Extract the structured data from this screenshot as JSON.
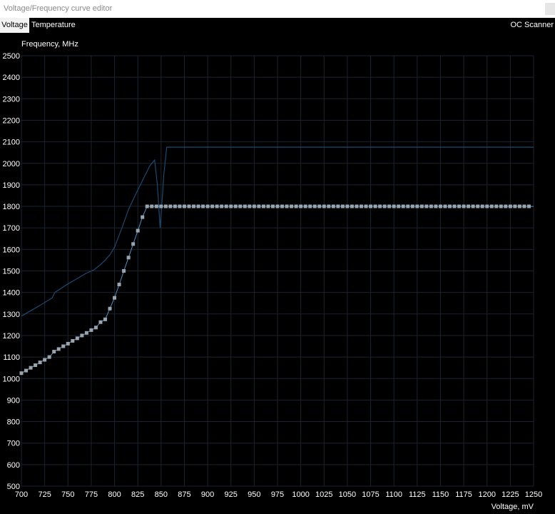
{
  "window": {
    "title": "Voltage/Frequency curve editor"
  },
  "tabs": {
    "voltage": "Voltage",
    "temperature": "Temperature",
    "oc_scanner": "OC Scanner"
  },
  "colors": {
    "grid": "#1c232d",
    "curve": "#4a90c8",
    "reference": "#1a4a72",
    "point": "#9aa4ac",
    "axis_text": "#ffffff"
  },
  "chart_data": {
    "type": "line",
    "xlabel": "Voltage, mV",
    "ylabel": "Frequency, MHz",
    "xlim": [
      700,
      1250
    ],
    "ylim": [
      500,
      2500
    ],
    "x_ticks": [
      700,
      725,
      750,
      775,
      800,
      825,
      850,
      875,
      900,
      925,
      950,
      975,
      1000,
      1025,
      1050,
      1075,
      1100,
      1125,
      1150,
      1175,
      1200,
      1225,
      1250
    ],
    "y_ticks": [
      500,
      600,
      700,
      800,
      900,
      1000,
      1100,
      1200,
      1300,
      1400,
      1500,
      1600,
      1700,
      1800,
      1900,
      2000,
      2100,
      2200,
      2300,
      2400,
      2500
    ],
    "grid": true,
    "series": [
      {
        "role": "curve",
        "x": [
          700,
          705,
          710,
          715,
          720,
          725,
          730,
          735,
          740,
          745,
          750,
          755,
          760,
          765,
          770,
          775,
          780,
          785,
          790,
          795,
          800,
          805,
          810,
          815,
          820,
          825,
          830,
          835,
          840,
          845,
          850,
          855,
          860,
          865,
          870,
          875,
          880,
          885,
          890,
          895,
          900,
          905,
          910,
          915,
          920,
          925,
          930,
          935,
          940,
          945,
          950,
          955,
          960,
          965,
          970,
          975,
          980,
          985,
          990,
          995,
          1000,
          1005,
          1010,
          1015,
          1020,
          1025,
          1030,
          1035,
          1040,
          1045,
          1050,
          1055,
          1060,
          1065,
          1070,
          1075,
          1080,
          1085,
          1090,
          1095,
          1100,
          1105,
          1110,
          1115,
          1120,
          1125,
          1130,
          1135,
          1140,
          1145,
          1150,
          1155,
          1160,
          1165,
          1170,
          1175,
          1180,
          1185,
          1190,
          1195,
          1200,
          1205,
          1210,
          1215,
          1220,
          1225,
          1230,
          1235,
          1240,
          1245,
          1250
        ],
        "y": [
          1025,
          1037,
          1050,
          1062,
          1075,
          1087,
          1100,
          1125,
          1137,
          1150,
          1162,
          1175,
          1187,
          1200,
          1212,
          1225,
          1237,
          1262,
          1275,
          1325,
          1375,
          1437,
          1500,
          1562,
          1625,
          1687,
          1750,
          1800,
          1800,
          1800,
          1800,
          1800,
          1800,
          1800,
          1800,
          1800,
          1800,
          1800,
          1800,
          1800,
          1800,
          1800,
          1800,
          1800,
          1800,
          1800,
          1800,
          1800,
          1800,
          1800,
          1800,
          1800,
          1800,
          1800,
          1800,
          1800,
          1800,
          1800,
          1800,
          1800,
          1800,
          1800,
          1800,
          1800,
          1800,
          1800,
          1800,
          1800,
          1800,
          1800,
          1800,
          1800,
          1800,
          1800,
          1800,
          1800,
          1800,
          1800,
          1800,
          1800,
          1800,
          1800,
          1800,
          1800,
          1800,
          1800,
          1800,
          1800,
          1800,
          1800,
          1800,
          1800,
          1800,
          1800,
          1800,
          1800,
          1800,
          1800,
          1800,
          1800,
          1800,
          1800,
          1800,
          1800,
          1800,
          1800,
          1800,
          1800,
          1800,
          1800,
          1800
        ],
        "markers_until": 1245
      },
      {
        "role": "reference",
        "x": [
          700,
          720,
          733,
          736,
          750,
          770,
          778,
          785,
          790,
          795,
          800,
          808,
          815,
          822,
          830,
          838,
          843,
          846,
          849,
          851,
          853,
          856,
          860,
          900,
          1000,
          1100,
          1200,
          1250
        ],
        "y": [
          1290,
          1340,
          1375,
          1400,
          1440,
          1490,
          1505,
          1530,
          1550,
          1575,
          1610,
          1700,
          1785,
          1850,
          1920,
          1990,
          2015,
          1900,
          1700,
          1820,
          1950,
          2075,
          2075,
          2075,
          2075,
          2075,
          2075,
          2075
        ]
      }
    ]
  }
}
